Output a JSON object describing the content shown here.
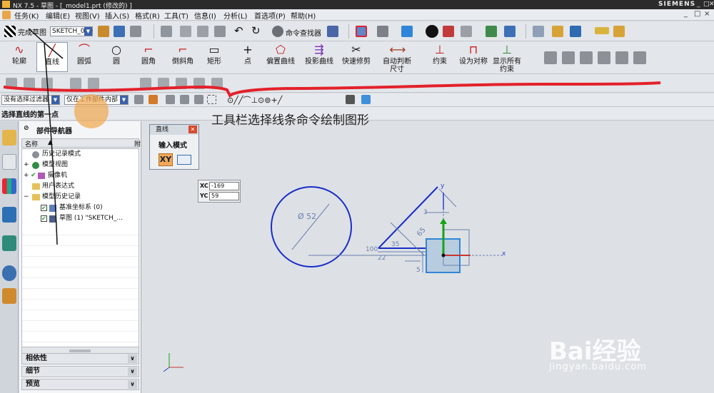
{
  "titlebar": {
    "title": "NX 7.5 - 草图 - [_model1.prt  (修改的) ]",
    "brand": "SIEMENS",
    "controls": [
      "_",
      "□",
      "✕"
    ]
  },
  "menubar": {
    "items": [
      "任务(K)",
      "编辑(E)",
      "视图(V)",
      "插入(S)",
      "格式(R)",
      "工具(T)",
      "信息(I)",
      "分析(L)",
      "首选项(P)",
      "帮助(H)"
    ],
    "right_controls": [
      "_",
      "□",
      "×"
    ]
  },
  "toolbar1": {
    "finish_sketch_label": "完成草图",
    "sketch_name": "SKETCH_000",
    "command_finder_label": "命令查找器"
  },
  "toolbar2": {
    "buttons": [
      {
        "label": "轮廓",
        "glyph": "∿"
      },
      {
        "label": "直线",
        "glyph": "╱"
      },
      {
        "label": "圆弧",
        "glyph": "⌒"
      },
      {
        "label": "圆",
        "glyph": "○"
      },
      {
        "label": "圆角",
        "glyph": "⌐"
      },
      {
        "label": "倒斜角",
        "glyph": "⌐"
      },
      {
        "label": "矩形",
        "glyph": "▭"
      },
      {
        "label": "点",
        "glyph": "+"
      },
      {
        "label": "偏置曲线",
        "glyph": "⬠"
      },
      {
        "label": "投影曲线",
        "glyph": "⇶"
      },
      {
        "label": "快速修剪",
        "glyph": "✂"
      },
      {
        "label": "自动判断尺寸",
        "glyph": "⟷"
      },
      {
        "label": "约束",
        "glyph": "⊥"
      },
      {
        "label": "设为对称",
        "glyph": "⊓"
      },
      {
        "label": "显示所有约束",
        "glyph": "⊥"
      }
    ]
  },
  "selectionbar": {
    "filter": "没有选择过滤器",
    "scope": "仅在工作部件内部"
  },
  "cue": {
    "text": "选择直线的第一点"
  },
  "navigator": {
    "title": "部件导航器",
    "col_name": "名称",
    "col_sort": "▲",
    "col_right": "附",
    "rows": [
      {
        "label": "历史记录模式",
        "indent": 0
      },
      {
        "label": "模型视图",
        "indent": 0
      },
      {
        "label": "摄像机",
        "indent": 0
      },
      {
        "label": "用户表达式",
        "indent": 0
      },
      {
        "label": "模型历史记录",
        "indent": 0
      },
      {
        "label": "基准坐标系 (0)",
        "indent": 1
      },
      {
        "label": "草图 (1) \"SKETCH_...",
        "indent": 1
      }
    ],
    "panels": [
      "相依性",
      "细节",
      "预览"
    ]
  },
  "line_dialog": {
    "title": "直线",
    "section": "输入模式",
    "xy_label": "XY"
  },
  "coords": {
    "xc_label": "XC",
    "xc_value": "-169",
    "yc_label": "YC",
    "yc_value": "59"
  },
  "annotation": {
    "text": "工具栏选择线条命令绘制图形"
  },
  "sketch_dims": {
    "circle_dia": "Ø 52",
    "d1": "100",
    "d2": "65",
    "d3": "3",
    "d4": "35",
    "d5": "22",
    "d6": "5",
    "x_axis": "x",
    "y_axis": "y"
  },
  "watermark": {
    "brand": "Bai经验",
    "url": "jingyan.baidu.com"
  },
  "colors": {
    "accent_red": "#e3212b",
    "sketch_blue": "#1a2ec8",
    "dim_blue": "#6b7fb0",
    "csys_green": "#17a317"
  }
}
